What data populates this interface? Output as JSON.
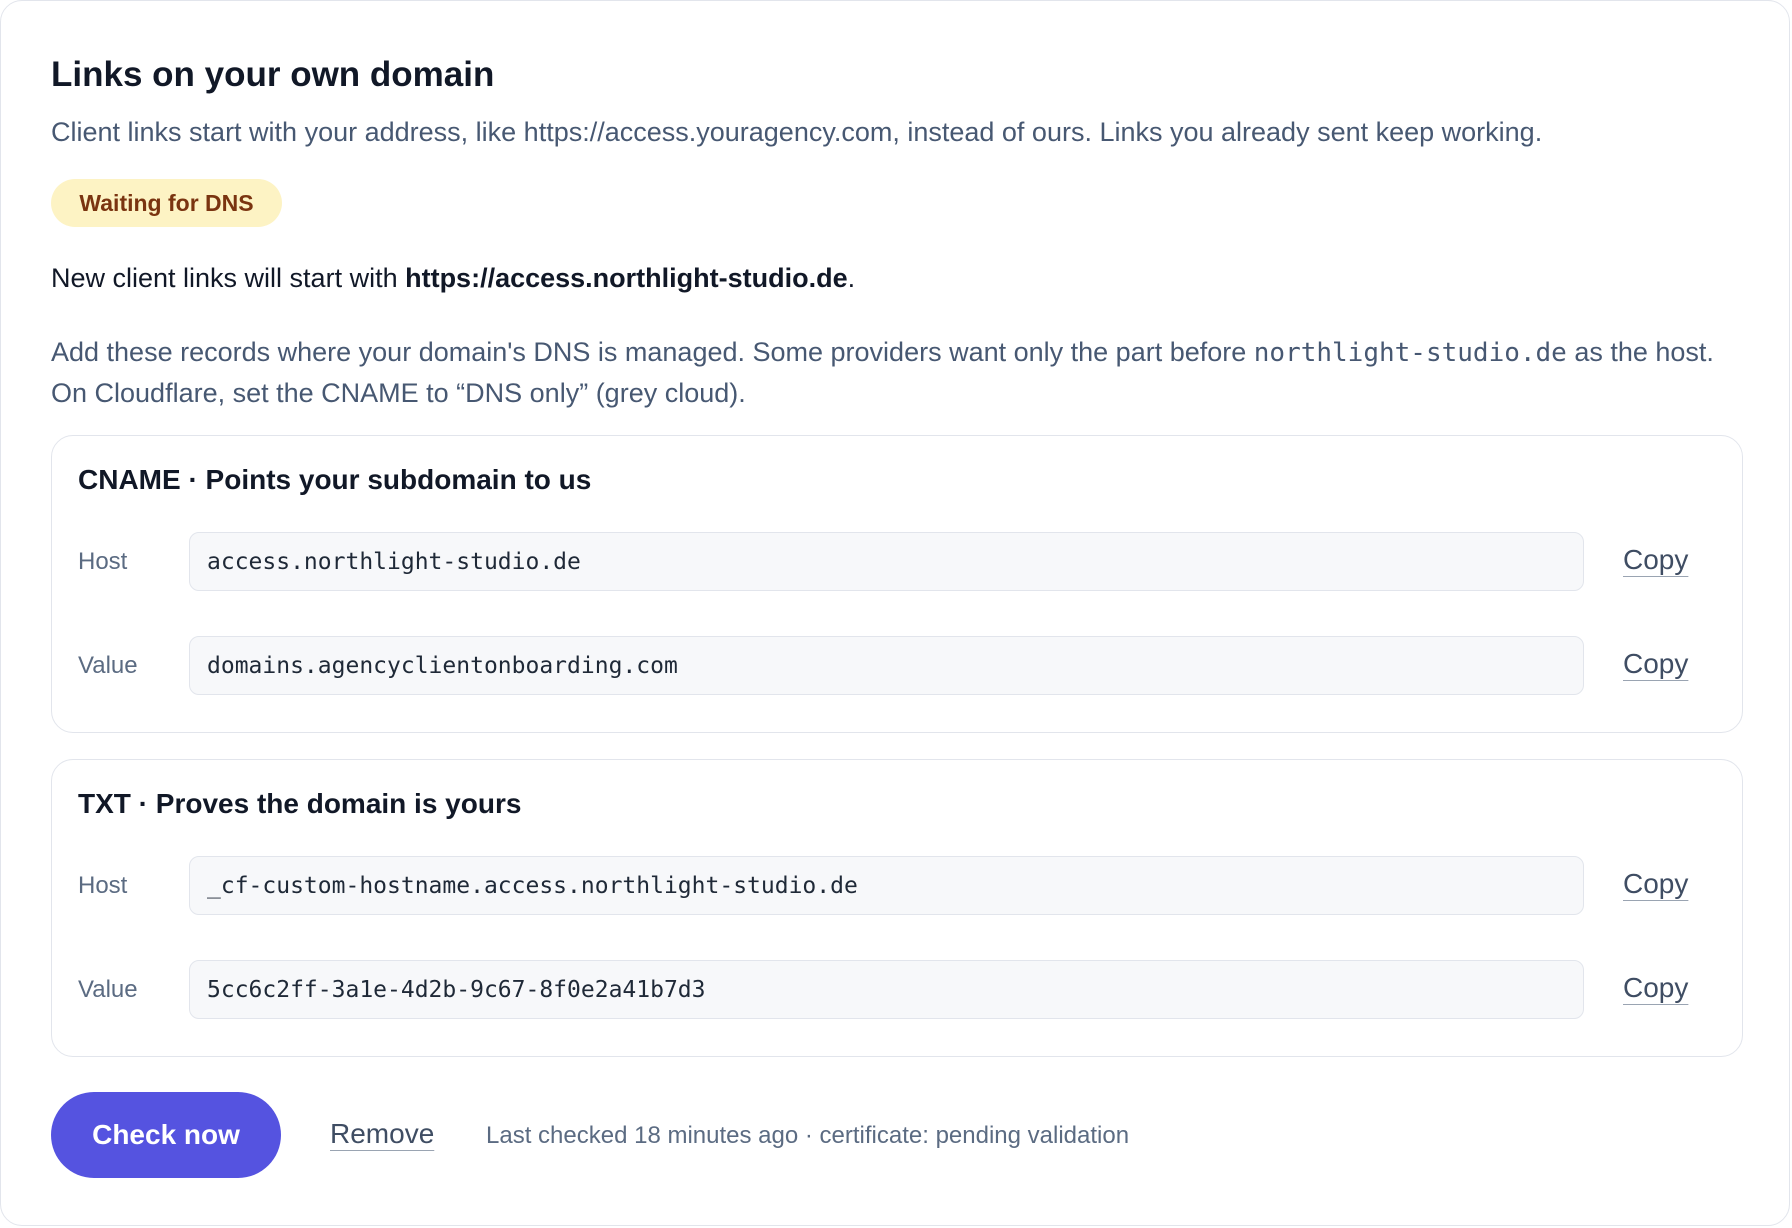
{
  "title": "Links on your own domain",
  "subtitle": "Client links start with your address, like https://access.youragency.com, instead of ours. Links you already sent keep working.",
  "status_badge": "Waiting for DNS",
  "new_links": {
    "prefix": "New client links will start with ",
    "url": "https://access.northlight-studio.de",
    "suffix": "."
  },
  "instructions": {
    "part1": "Add these records where your domain's DNS is managed. Some providers want only the part before ",
    "domain": "northlight-studio.de",
    "part2": " as the host. On Cloudflare, set the CNAME to “DNS only” (grey cloud)."
  },
  "records": [
    {
      "heading": "CNAME · Points your subdomain to us",
      "host_label": "Host",
      "host_value": "access.northlight-studio.de",
      "value_label": "Value",
      "value_value": "domains.agencyclientonboarding.com",
      "copy_label": "Copy"
    },
    {
      "heading": "TXT · Proves the domain is yours",
      "host_label": "Host",
      "host_value": "_cf-custom-hostname.access.northlight-studio.de",
      "value_label": "Value",
      "value_value": "5cc6c2ff-3a1e-4d2b-9c67-8f0e2a41b7d3",
      "copy_label": "Copy"
    }
  ],
  "actions": {
    "check_now": "Check now",
    "remove": "Remove",
    "status_text": "Last checked 18 minutes ago · certificate: pending validation"
  },
  "colors": {
    "primary": "#5553e0",
    "badge_bg": "#fdf3c4",
    "badge_text": "#7a3410",
    "muted_text": "#475872"
  }
}
